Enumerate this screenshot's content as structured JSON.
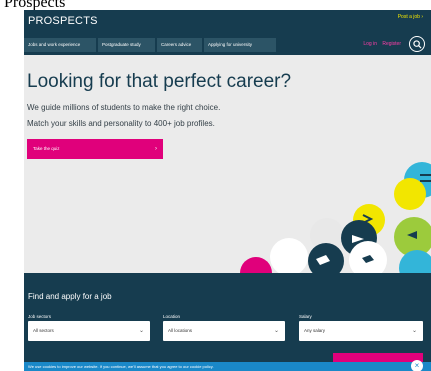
{
  "browser_title": "Prospects",
  "header": {
    "brand": "PROSPECTS",
    "post_job": "Post a job ›",
    "tabs": [
      "Jobs and work experience",
      "Postgraduate study",
      "Careers advice",
      "Applying for university"
    ],
    "login": "Log in",
    "register": "Register",
    "search_icon": "search-icon"
  },
  "hero": {
    "title": "Looking for that perfect career?",
    "subtitle_line1": "We guide millions of students to make the right choice.",
    "subtitle_line2": "Match your skills and personality to 400+ job profiles.",
    "quiz_button": "Take the quiz",
    "quiz_arrow": "›"
  },
  "finder": {
    "title": "Find and apply for a job",
    "fields": [
      {
        "label": "Job sectors",
        "value": "All sectors"
      },
      {
        "label": "Location",
        "value": "All locations"
      },
      {
        "label": "Salary",
        "value": "Any salary"
      }
    ],
    "chevron": "⌄"
  },
  "cookie": {
    "text": "We use cookies to improve our website. If you continue, we'll assume that you agree to our cookie policy.",
    "close": "×"
  },
  "colors": {
    "navy": "#163c4f",
    "tab": "#2c5466",
    "pink": "#e0007b",
    "yellow": "#f2e600",
    "cookie_blue": "#1a88c8",
    "hero_bg": "#ebebeb"
  }
}
